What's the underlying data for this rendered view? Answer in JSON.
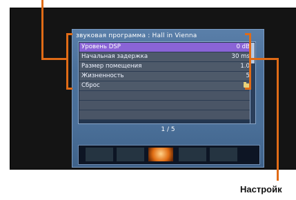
{
  "osd": {
    "title": "звуковая программа : Hall in Vienna",
    "rows": [
      {
        "label": "Уровень DSP",
        "value": "0 dB"
      },
      {
        "label": "Начальная задержка",
        "value": "30 ms"
      },
      {
        "label": "Размер помещения",
        "value": "1.0"
      },
      {
        "label": "Жизненность",
        "value": "5"
      },
      {
        "label": "Сброс",
        "value": ""
      }
    ],
    "page": "1 / 5"
  },
  "caption": "Настройк",
  "colors": {
    "accent": "#e06b16",
    "selected": "#8a64d6",
    "osd_bg": "#4b709a"
  }
}
